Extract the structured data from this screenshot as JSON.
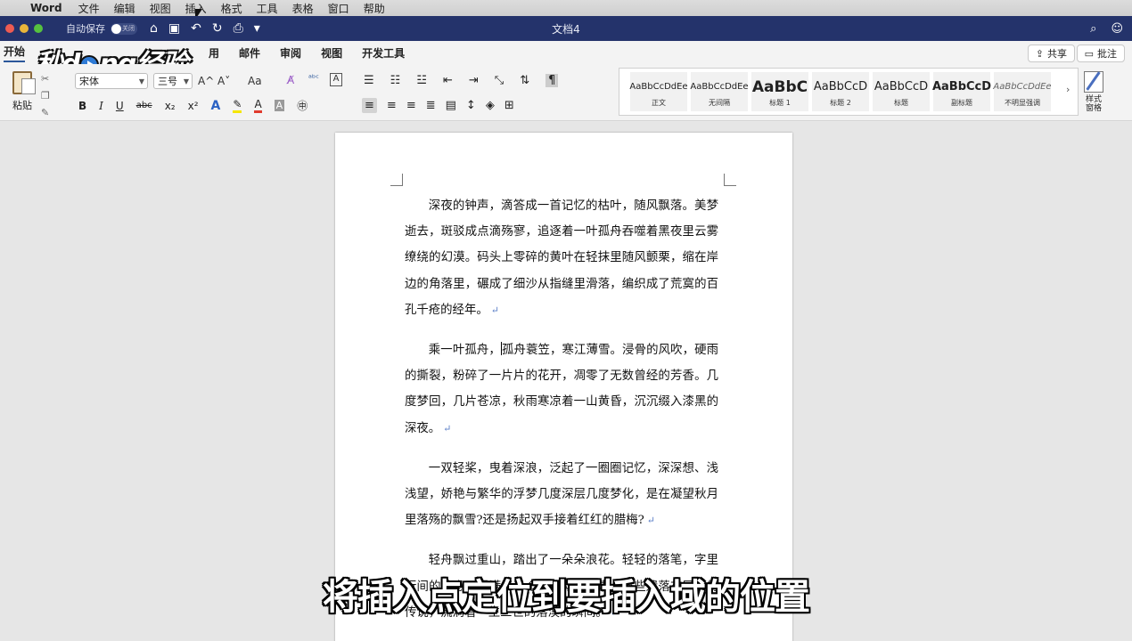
{
  "menubar": {
    "app_name": "Word",
    "items": [
      "文件",
      "编辑",
      "视图",
      "插入",
      "格式",
      "工具",
      "表格",
      "窗口",
      "帮助"
    ]
  },
  "titlebar": {
    "autosave_label": "自动保存",
    "autosave_state": "关闭",
    "document_title": "文档4"
  },
  "logo_text": {
    "part1": "秒d",
    "part2": "ng经验"
  },
  "ribbon_tabs": [
    "开始",
    "用",
    "邮件",
    "审阅",
    "视图",
    "开发工具"
  ],
  "share_label": "共享",
  "comment_label": "批注",
  "ribbon": {
    "paste_label": "粘贴",
    "font_name": "宋体",
    "font_size": "三号",
    "grow_font": "A^",
    "shrink_font": "A˅",
    "change_case": "Aa",
    "bold": "B",
    "italic": "I",
    "underline": "U",
    "strikethrough": "abc",
    "subscript": "x₂",
    "superscript": "x²",
    "text_effects": "A",
    "font_color": "A",
    "char_shading": "A"
  },
  "styles": [
    {
      "preview": "AaBbCcDdEe",
      "name": "正文",
      "variant": ""
    },
    {
      "preview": "AaBbCcDdEe",
      "name": "无间隔",
      "variant": ""
    },
    {
      "preview": "AaBbC",
      "name": "标题 1",
      "variant": "big"
    },
    {
      "preview": "AaBbCcD",
      "name": "标题 2",
      "variant": "h2"
    },
    {
      "preview": "AaBbCcD",
      "name": "标题",
      "variant": "h2"
    },
    {
      "preview": "AaBbCcD",
      "name": "副标题",
      "variant": "h3"
    },
    {
      "preview": "AaBbCcDdEe",
      "name": "不明显强调",
      "variant": "em"
    }
  ],
  "styles_pane_label": {
    "line1": "样式",
    "line2": "窗格"
  },
  "document": {
    "paragraphs": [
      "深夜的钟声，滴答成一首记忆的枯叶，随风飘落。美梦逝去，斑驳成点滴殇寥，追逐着一叶孤舟吞噬着黑夜里云雾缭绕的幻漠。码头上零碎的黄叶在轻抹里随风颤栗，缩在岸边的角落里，碾成了细沙从指缝里滑落，编织成了荒寞的百孔千疮的经年。",
      "孤舟蓑笠，寒江薄雪。浸骨的风吹，硬雨的撕裂，粉碎了一片片的花开，凋零了无数曾经的芳香。几度梦回，几片苍凉，秋雨寒凉着一山黄昏，沉沉缀入漆黑的深夜。",
      "一双轻桨，曳着深浪，泛起了一圈圈记忆，深深想、浅浅望，娇艳与繁华的浮梦几度深层几度梦化，是在凝望秋月里落殇的飘雪?还是扬起双手接着红红的腊梅?",
      "轻舟飘过重山，踏出了一朵朵浪花。轻轻的落笔，字里行间的诗意，浸满了一个个灵动的故事，那些遗落在民间的传说，流淌着一生三世的落漠的瞬间。"
    ],
    "para2_before_caret": "乘一叶孤舟，",
    "pilcrow": "↵"
  },
  "subtitle": "将插入点定位到要插入域的位置"
}
